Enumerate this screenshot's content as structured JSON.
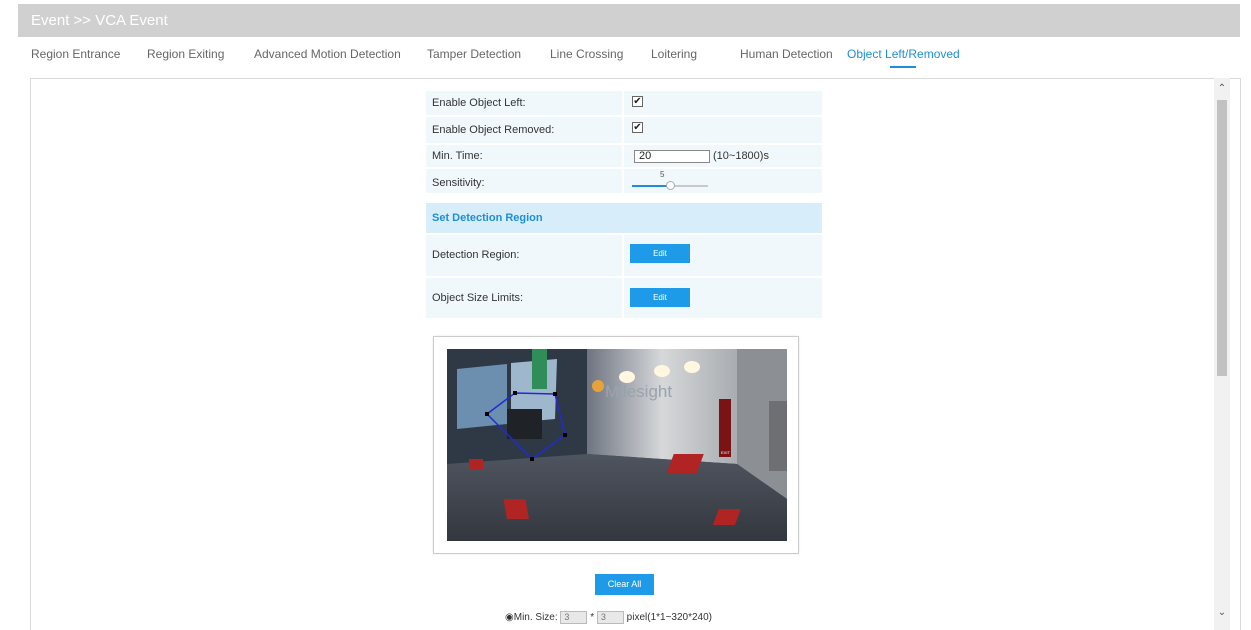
{
  "header": {
    "title": "Event >> VCA Event"
  },
  "tabs": [
    {
      "label": "Region Entrance"
    },
    {
      "label": "Region Exiting"
    },
    {
      "label": "Advanced Motion Detection"
    },
    {
      "label": "Tamper Detection"
    },
    {
      "label": "Line Crossing"
    },
    {
      "label": "Loitering"
    },
    {
      "label": "Human Detection"
    },
    {
      "label": "Object Left/Removed",
      "active": true
    }
  ],
  "form": {
    "enable_left_label": "Enable Object Left:",
    "enable_left_checked": true,
    "enable_removed_label": "Enable Object Removed:",
    "enable_removed_checked": true,
    "min_time_label": "Min. Time:",
    "min_time_value": "20",
    "min_time_range": "(10~1800)s",
    "sensitivity_label": "Sensitivity:",
    "sensitivity_value": "5",
    "sensitivity_level": 0.5,
    "detection_header": "Set Detection Region",
    "detection_region_label": "Detection Region:",
    "detection_region_button": "Edit",
    "object_size_label": "Object Size Limits:",
    "object_size_button": "Edit"
  },
  "camera": {
    "logo_text": "Milesight",
    "marker_text": "EXIT"
  },
  "actions": {
    "clear_all": "Clear All"
  },
  "min_size": {
    "label": "Min. Size:",
    "width": "3",
    "times": "*",
    "height": "3",
    "unit": "pixel(1*1~320*240)"
  },
  "colors": {
    "accent": "#1e8fd6",
    "button": "#1e9be8",
    "row_bg": "#f1f8fc",
    "header_bg": "#d7eefa",
    "titlebar": "#d0d0d0"
  },
  "icons": {
    "checkbox": "checkmark",
    "radio": "radio-selected",
    "scroll_up": "chevron-up-icon",
    "scroll_down": "chevron-down-icon"
  }
}
